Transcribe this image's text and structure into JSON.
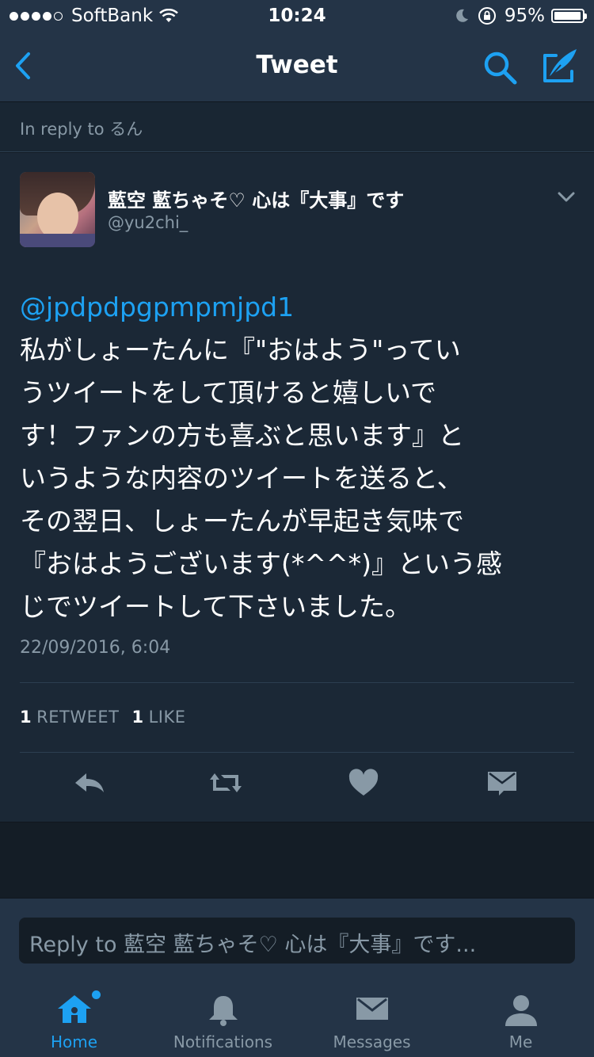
{
  "status_bar": {
    "carrier": "SoftBank",
    "time": "10:24",
    "battery": "95%"
  },
  "nav": {
    "title": "Tweet"
  },
  "in_reply": "In reply to るん",
  "tweet": {
    "display_name": "藍空 藍ちゃそ♡ 心は『大事』です",
    "handle": "@yu2chi_",
    "mention": "@jpdpdpgpmpmjpd1",
    "text": "私がしょーたんに『\"おはよう\"ってい\nうツイートをして頂けると嬉しいで\nす！ファンの方も喜ぶと思います』と\nいうような内容のツイートを送ると、\nその翌日、しょーたんが早起き気味で\n『おはようございます(*^^*)』という感\nじでツイートして下さいました。",
    "timestamp": "22/09/2016, 6:04",
    "retweet_count": "1",
    "retweet_label": "RETWEET",
    "like_count": "1",
    "like_label": "LIKE"
  },
  "reply_placeholder": "Reply to 藍空 藍ちゃそ♡ 心は『大事』です...",
  "tabs": [
    {
      "label": "Home",
      "icon": "home-icon",
      "active": true
    },
    {
      "label": "Notifications",
      "icon": "bell-icon",
      "active": false
    },
    {
      "label": "Messages",
      "icon": "envelope-icon",
      "active": false
    },
    {
      "label": "Me",
      "icon": "person-icon",
      "active": false
    }
  ],
  "colors": {
    "accent": "#1da1f2",
    "background": "#141d26",
    "card": "#1b2836",
    "bar": "#243447",
    "muted": "#8899a6"
  }
}
